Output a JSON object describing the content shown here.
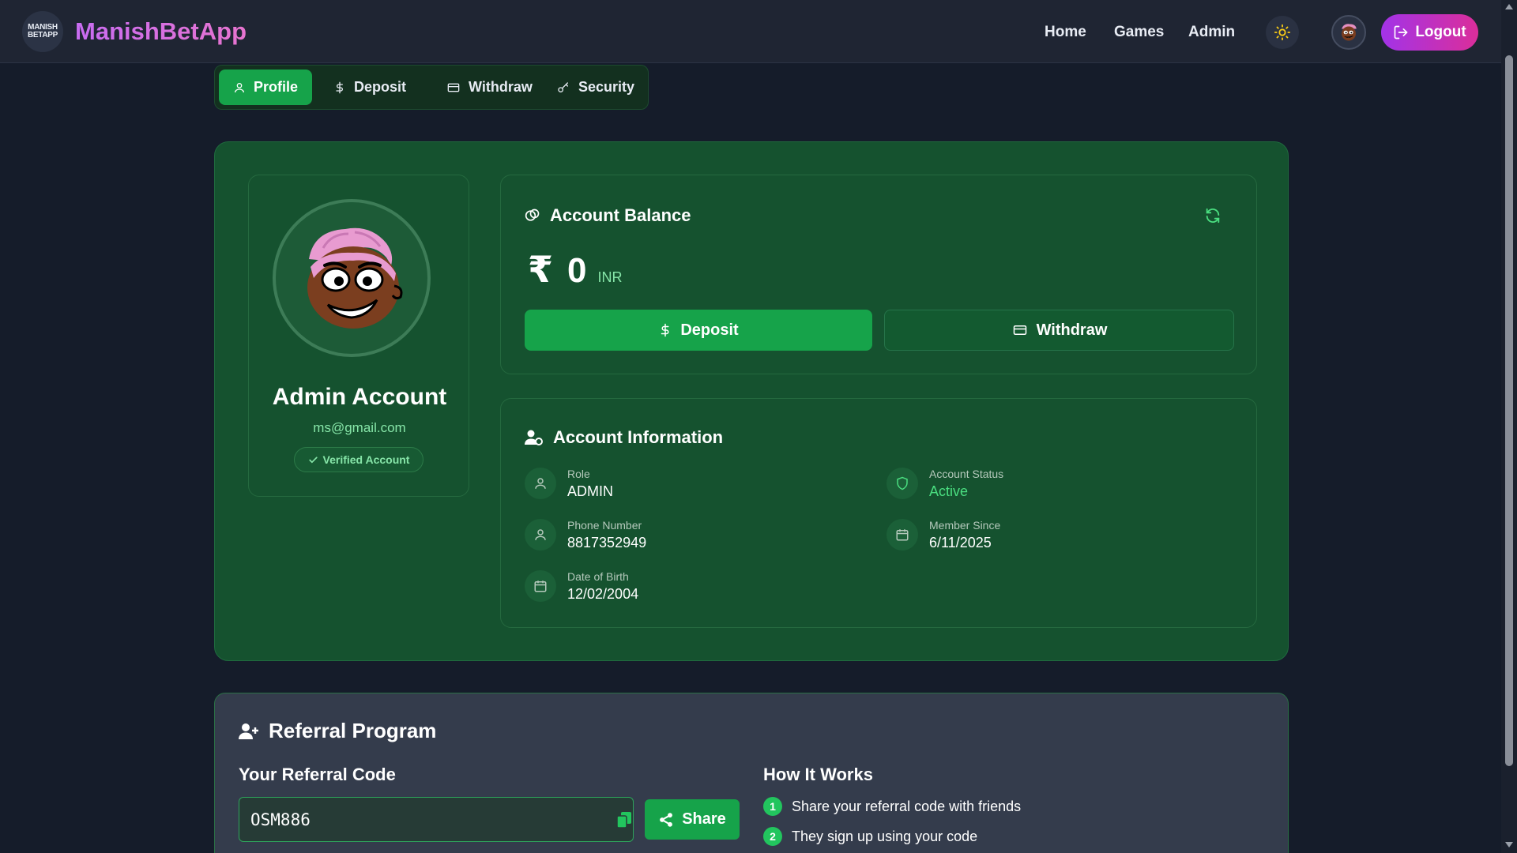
{
  "app": {
    "logo_text": "MANISH BETAPP",
    "brand": "ManishBetApp"
  },
  "nav": {
    "links": [
      "Home",
      "Games",
      "Admin"
    ],
    "logout_label": "Logout"
  },
  "tabs": [
    {
      "label": "Profile",
      "icon": "user-icon",
      "active": true
    },
    {
      "label": "Deposit",
      "icon": "dollar-icon",
      "active": false
    },
    {
      "label": "Withdraw",
      "icon": "card-icon",
      "active": false
    },
    {
      "label": "Security",
      "icon": "key-icon",
      "active": false
    }
  ],
  "profile": {
    "name": "Admin Account",
    "email": "ms@gmail.com",
    "verified_label": "Verified Account"
  },
  "balance": {
    "title": "Account Balance",
    "currency_symbol": "₹",
    "amount": "0",
    "currency": "INR",
    "deposit_label": "Deposit",
    "withdraw_label": "Withdraw"
  },
  "account_info": {
    "title": "Account Information",
    "items": [
      {
        "label": "Role",
        "value": "ADMIN",
        "icon": "user-icon"
      },
      {
        "label": "Account Status",
        "value": "Active",
        "icon": "shield-icon"
      },
      {
        "label": "Phone Number",
        "value": "8817352949",
        "icon": "user-icon"
      },
      {
        "label": "Member Since",
        "value": "6/11/2025",
        "icon": "calendar-icon"
      },
      {
        "label": "Date of Birth",
        "value": "12/02/2004",
        "icon": "calendar-icon"
      }
    ]
  },
  "referral": {
    "title": "Referral Program",
    "code_heading": "Your Referral Code",
    "code": "OSM886",
    "share_label": "Share",
    "how_heading": "How It Works",
    "steps": [
      {
        "num": "1",
        "text": "Share your referral code with friends"
      },
      {
        "num": "2",
        "text": "They sign up using your code"
      }
    ]
  },
  "colors": {
    "accent_green": "#16a34a",
    "panel_green": "#15522f",
    "brand_gradient_start": "#c86cf2",
    "logout_gradient_start": "#a233e8",
    "logout_gradient_end": "#db2e9a",
    "background": "#151c2a"
  }
}
